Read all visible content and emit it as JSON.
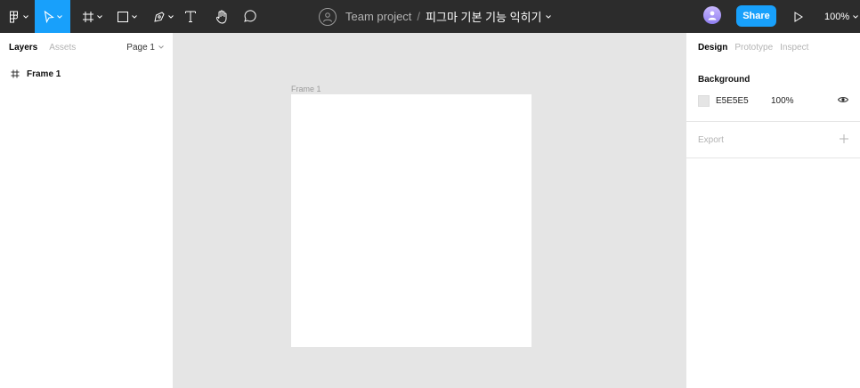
{
  "toolbar": {
    "team_name": "Team project",
    "separator": "/",
    "file_name": "피그마 기본 기능 익히기",
    "share_label": "Share",
    "zoom_label": "100%",
    "accent_color": "#18a0fb",
    "icons": [
      "figma-menu-icon",
      "move-tool-icon",
      "frame-tool-icon",
      "shape-tool-icon",
      "pen-tool-icon",
      "text-tool-icon",
      "hand-tool-icon",
      "comment-tool-icon",
      "play-icon"
    ]
  },
  "left_panel": {
    "tab_layers": "Layers",
    "tab_assets": "Assets",
    "page_label": "Page 1",
    "layers": [
      {
        "name": "Frame 1",
        "icon": "frame-icon"
      }
    ]
  },
  "canvas": {
    "frame_label": "Frame 1",
    "background_color": "#e5e5e5"
  },
  "right_panel": {
    "tab_design": "Design",
    "tab_prototype": "Prototype",
    "tab_inspect": "Inspect",
    "background": {
      "title": "Background",
      "hex": "E5E5E5",
      "opacity": "100%"
    },
    "export_title": "Export"
  }
}
